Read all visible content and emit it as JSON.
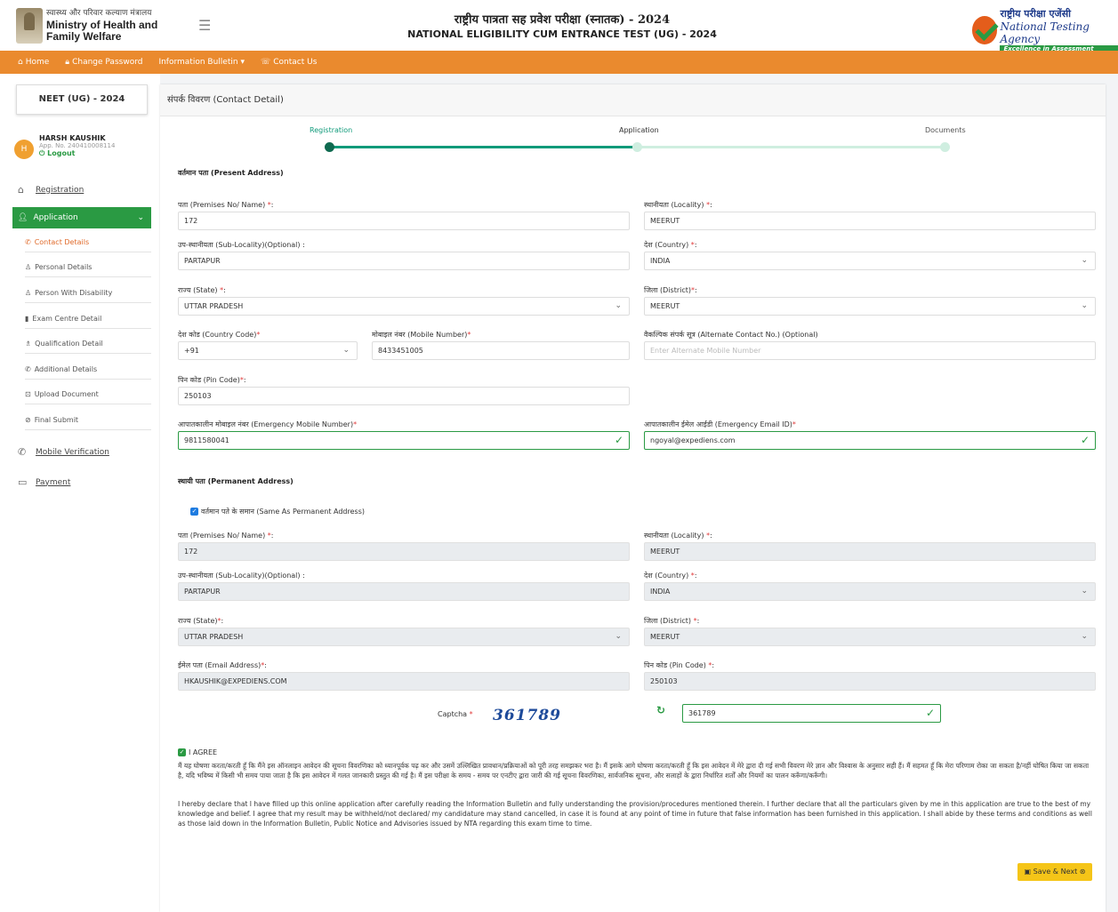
{
  "header": {
    "ministry_hi": "स्वास्थ्य और परिवार कल्याण मंत्रालय",
    "ministry_en_1": "Ministry of Health and",
    "ministry_en_2": "Family Welfare",
    "title_hi": "राष्ट्रीय पात्रता सह प्रवेश परीक्षा (स्नातक) - 2024",
    "title_en": "NATIONAL ELIGIBILITY CUM ENTRANCE TEST (UG) - 2024",
    "nta_hi": "राष्ट्रीय परीक्षा एजेंसी",
    "nta_en": "National Testing Agency",
    "nta_tagline": "Excellence in Assessment"
  },
  "nav": {
    "home": "Home",
    "change_password": "Change Password",
    "info_bulletin": "Information Bulletin",
    "contact": "Contact Us"
  },
  "sidebar": {
    "exam": "NEET (UG) - 2024",
    "user_name": "HARSH KAUSHIK",
    "app_no": "App. No. 240410008114",
    "logout": "Logout",
    "avatar_initial": "H",
    "registration": "Registration",
    "application": "Application",
    "sub_items": [
      "Contact Details",
      "Personal Details",
      "Person With Disability",
      "Exam Centre Detail",
      "Qualification Detail",
      "Additional Details",
      "Upload Document",
      "Final Submit"
    ],
    "mobile_verification": "Mobile Verification",
    "payment": "Payment"
  },
  "main": {
    "heading": "संपर्क विवरण (Contact Detail)",
    "steps": [
      "Registration",
      "Application",
      "Documents"
    ],
    "present_address": "वर्तमान पता (Present Address)",
    "permanent_address": "स्थायी पता (Permanent Address)",
    "same_as": "वर्तमान पते के समान (Same As Permanent Address)",
    "labels": {
      "premises": "पता (Premises No/ Name)",
      "locality": "स्थानीयता (Locality)",
      "sub_locality": "उप-स्थानीयता (Sub-Locality)(Optional) :",
      "country": "देश (Country)",
      "state": "राज्य (State)",
      "district": "जिला (District)",
      "country_code": "देश कोड (Country Code)",
      "mobile": "मोबाइल नंबर (Mobile Number)",
      "alt_contact": "वैकल्पिक संपर्क सूत्र (Alternate Contact No.) (Optional)",
      "pin": "पिन कोड (Pin Code)",
      "emergency_mobile": "आपातकालीन मोबाइल नंबर (Emergency Mobile Number)",
      "emergency_email": "आपातकालीन ईमेल आईडी (Emergency Email ID)",
      "email": "ईमेल पता (Email Address)",
      "captcha": "Captcha"
    },
    "present": {
      "premises": "172",
      "locality": "MEERUT",
      "sub_locality": "PARTAPUR",
      "country": "INDIA",
      "state": "UTTAR PRADESH",
      "district": "MEERUT",
      "country_code": "+91",
      "mobile": "8433451005",
      "alt_placeholder": "Enter Alternate Mobile Number",
      "pin": "250103",
      "emergency_mobile": "9811580041",
      "emergency_email": "ngoyal@expediens.com"
    },
    "permanent": {
      "premises": "172",
      "locality": "MEERUT",
      "sub_locality": "PARTAPUR",
      "country": "INDIA",
      "state": "UTTAR PRADESH",
      "district": "MEERUT",
      "email": "HKAUSHIK@EXPEDIENS.COM",
      "pin": "250103"
    },
    "captcha_image": "361789",
    "captcha_value": "361789",
    "agree_label": "I AGREE",
    "agree_hi": "मैं यह घोषणा करता/करती हूँ कि मैंने इस ऑनलाइन आवेदन की सूचना विवरणिका को ध्यानपूर्वक पढ़ कर और उसमें उल्लिखित प्रावधान/प्रक्रियाओं को पूरी तरह समझकर भरा है। मैं इसके आगे घोषणा करता/करती हूँ कि इस आवेदन में मेरे द्वारा दी गई सभी विवरण मेरे ज्ञान और विश्वास के अनुसार सही हैं। मैं सहमत हूँ कि मेरा परिणाम रोका जा सकता है/नहीं घोषित किया जा सकता है, यदि भविष्य में किसी भी समय पाया जाता है कि इस आवेदन में गलत जानकारी प्रस्तुत की गई है। मैं इस परीक्षा के समय - समय पर एनटीए द्वारा जारी की गई सूचना विवरणिका, सार्वजनिक सूचना, और सलाहों के द्वारा निर्धारित शर्तों और नियमों का पालन करूँगा/करूँगी।",
    "agree_en": "I hereby declare that I have filled up this online application after carefully reading the Information Bulletin and fully understanding the provision/procedures mentioned therein. I further declare that all the particulars given by me in this application are true to the best of my knowledge and belief. I agree that my result may be withheld/not declared/ my candidature may stand cancelled, in case it is found at any point of time in future that false information has been furnished in this application. I shall abide by these terms and conditions as well as those laid down in the Information Bulletin, Public Notice and Advisories issued by NTA regarding this exam time to time.",
    "save_next": "Save & Next"
  },
  "colors": {
    "nav_orange": "#ea8a2e",
    "active_green": "#2a9a43",
    "save_yellow": "#f5c518"
  }
}
